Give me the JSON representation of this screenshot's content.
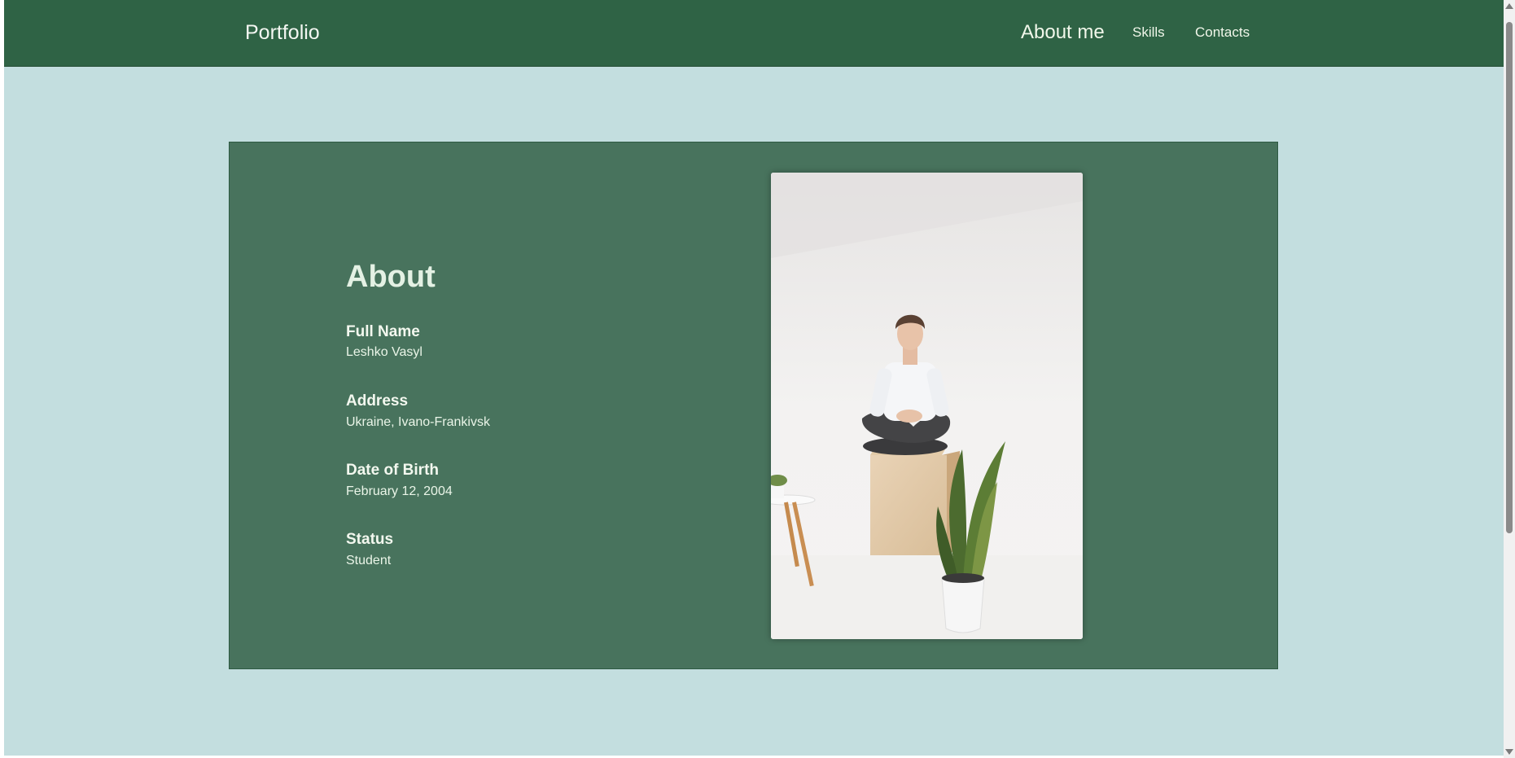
{
  "navbar": {
    "brand": "Portfolio",
    "items": [
      {
        "label": "About me"
      },
      {
        "label": "Skills"
      },
      {
        "label": "Contacts"
      }
    ]
  },
  "about": {
    "title": "About",
    "fields": [
      {
        "label": "Full Name",
        "value": "Leshko Vasyl"
      },
      {
        "label": "Address",
        "value": "Ukraine, Ivano-Frankivsk"
      },
      {
        "label": "Date of Birth",
        "value": "February 12, 2004"
      },
      {
        "label": "Status",
        "value": "Student"
      }
    ],
    "photo_subject": "person-sitting-on-wooden-box-with-plant"
  },
  "colors": {
    "page_background": "#c3dedf",
    "navbar": "#2f6345",
    "card": "#48735d",
    "title_text": "#e4f1e4",
    "body_text": "#f3f8ef"
  }
}
